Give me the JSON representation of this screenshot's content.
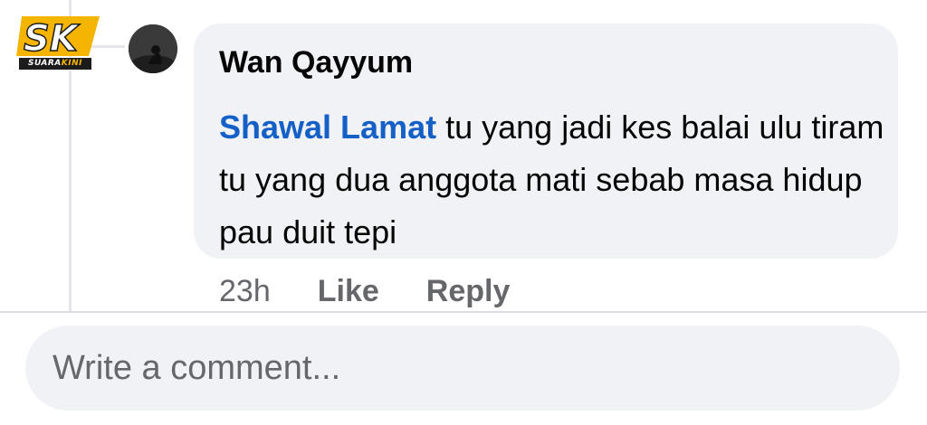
{
  "logo": {
    "initials": "SK",
    "wordmark_left": "SUARA",
    "wordmark_right": "KINI"
  },
  "comment": {
    "author": "Wan Qayyum",
    "mention": "Shawal Lamat",
    "body": " tu yang jadi kes balai ulu tiram tu yang dua anggota mati sebab masa hidup pau duit tepi",
    "time": "23h",
    "like_label": "Like",
    "reply_label": "Reply"
  },
  "composer": {
    "placeholder": "Write a comment..."
  },
  "colors": {
    "bubble_bg": "#f0f2f5",
    "mention": "#1560c7",
    "meta_text": "#65676b",
    "logo_accent": "#f4b400"
  }
}
